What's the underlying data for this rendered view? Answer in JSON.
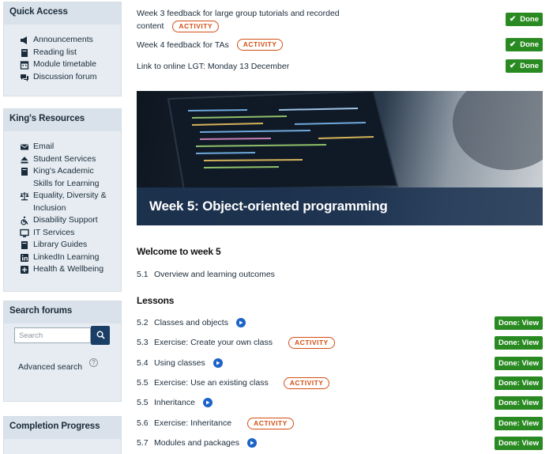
{
  "sidebar": {
    "quick_access": {
      "title": "Quick Access",
      "items": [
        {
          "label": "Announcements",
          "icon": "megaphone-icon"
        },
        {
          "label": "Reading list",
          "icon": "book-icon"
        },
        {
          "label": "Module timetable",
          "icon": "calendar-icon"
        },
        {
          "label": "Discussion forum",
          "icon": "comments-icon"
        }
      ]
    },
    "kings_resources": {
      "title": "King's Resources",
      "items": [
        {
          "label": "Email",
          "icon": "envelope-icon"
        },
        {
          "label": "Student Services",
          "icon": "eject-icon"
        },
        {
          "label": "King's Academic Skills for Learning",
          "icon": "book-icon"
        },
        {
          "label": "Equality, Diversity & Inclusion",
          "icon": "balance-scale-icon"
        },
        {
          "label": "Disability Support",
          "icon": "wheelchair-icon"
        },
        {
          "label": "IT Services",
          "icon": "desktop-icon"
        },
        {
          "label": "Library Guides",
          "icon": "book-icon"
        },
        {
          "label": "LinkedIn Learning",
          "icon": "linkedin-icon"
        },
        {
          "label": "Health & Wellbeing",
          "icon": "plus-square-icon"
        }
      ]
    },
    "search_forums": {
      "title": "Search forums",
      "placeholder": "Search",
      "advanced": "Advanced search",
      "help": "?"
    },
    "completion_progress": {
      "title": "Completion Progress"
    }
  },
  "main": {
    "feedback_rows": [
      {
        "text": "Week 3 feedback for large group tutorials and recorded",
        "text2": "content",
        "badge": "ACTIVITY",
        "done": "Done"
      },
      {
        "text": "Week 4 feedback for TAs",
        "badge": "ACTIVITY",
        "done": "Done"
      },
      {
        "text": "Link to online LGT: Monday 13 December",
        "done": "Done"
      }
    ],
    "banner_title": "Week 5: Object-oriented programming",
    "welcome_heading": "Welcome to week 5",
    "welcome_items": [
      {
        "num": "5.1",
        "text": "Overview and learning outcomes"
      }
    ],
    "lessons_heading": "Lessons",
    "lessons": [
      {
        "num": "5.2",
        "text": "Classes and objects",
        "kind": "video",
        "done": "Done: View"
      },
      {
        "num": "5.3",
        "text": "Exercise: Create your own class",
        "kind": "activity",
        "badge": "ACTIVITY",
        "done": "Done: View"
      },
      {
        "num": "5.4",
        "text": "Using classes",
        "kind": "video",
        "done": "Done: View"
      },
      {
        "num": "5.5",
        "text": "Exercise: Use an existing class",
        "kind": "activity",
        "badge": "ACTIVITY",
        "done": "Done: View"
      },
      {
        "num": "5.5",
        "text": "Inheritance",
        "kind": "video",
        "done": "Done: View"
      },
      {
        "num": "5.6",
        "text": "Exercise: Inheritance",
        "kind": "activity",
        "badge": "ACTIVITY",
        "done": "Done: View"
      },
      {
        "num": "5.7",
        "text": "Modules and packages",
        "kind": "video",
        "done": "Done: View"
      }
    ]
  },
  "colors": {
    "done_green": "#2a8a22",
    "activity_orange": "#d34d12",
    "play_blue": "#1c63c7",
    "navy": "#1b3e66",
    "sidebar_bg": "#e6ecf1"
  }
}
